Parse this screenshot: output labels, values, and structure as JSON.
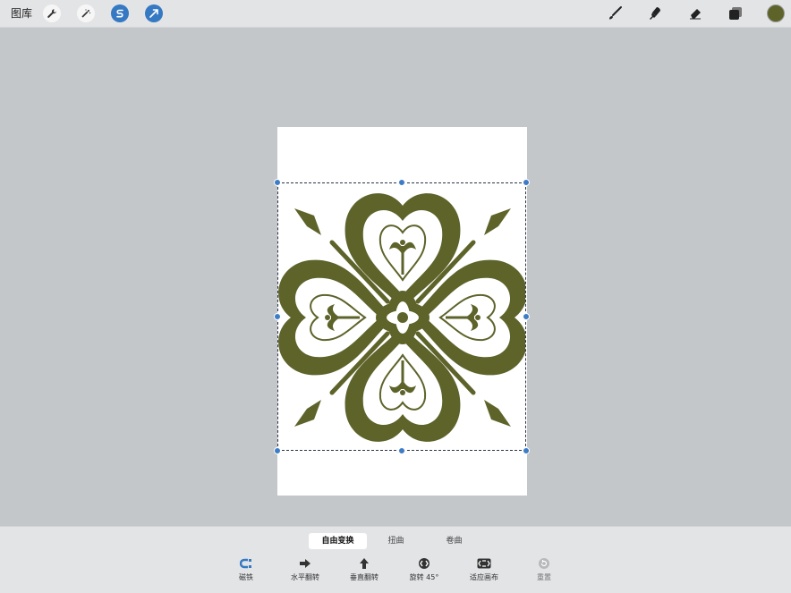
{
  "topbar": {
    "gallery_label": "图库",
    "left_tools": [
      {
        "icon": "wrench-icon"
      },
      {
        "icon": "magic-wand-icon"
      },
      {
        "icon": "selection-s-icon",
        "active": true
      },
      {
        "icon": "transform-arrow-icon",
        "active": true
      }
    ],
    "right_tools": [
      "brush-icon",
      "smudge-icon",
      "eraser-icon",
      "layers-icon"
    ],
    "current_color": "#5e632a"
  },
  "transform_modes": [
    {
      "label": "自由变换",
      "selected": true
    },
    {
      "label": "扭曲",
      "selected": false
    },
    {
      "label": "卷曲",
      "selected": false
    }
  ],
  "actions": [
    {
      "label": "磁铁",
      "icon": "magnet-icon"
    },
    {
      "label": "水平翻转",
      "icon": "flip-horizontal-icon"
    },
    {
      "label": "垂直翻转",
      "icon": "flip-vertical-icon"
    },
    {
      "label": "旋转 45°",
      "icon": "rotate-icon"
    },
    {
      "label": "适应画布",
      "icon": "fit-canvas-icon"
    },
    {
      "label": "重置",
      "icon": "reset-icon",
      "disabled": true
    }
  ],
  "colors": {
    "accent": "#3579c3",
    "artwork": "#5e632a",
    "canvas": "#ffffff",
    "background": "#c3c7ca"
  }
}
